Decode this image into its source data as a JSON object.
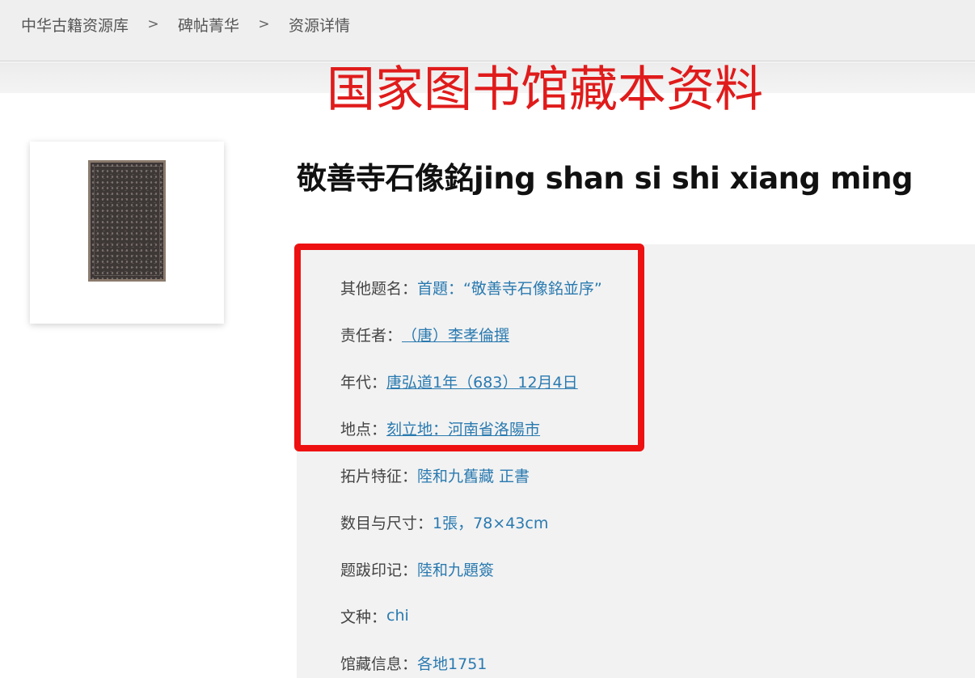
{
  "breadcrumb": {
    "items": [
      "中华古籍资源库",
      "碑帖菁华",
      "资源详情"
    ],
    "separator": ">"
  },
  "stamp_text": "国家图书馆藏本资料",
  "record": {
    "title": "敬善寺石像銘jing shan si shi xiang ming",
    "thumbnail_icon": "rubbing-thumbnail",
    "fields": [
      {
        "label": "其他题名：",
        "value": "首題：“敬善寺石像銘並序”"
      },
      {
        "label": "责任者：",
        "value": "（唐）李孝倫撰"
      },
      {
        "label": "年代：",
        "value": "唐弘道1年（683）12月4日"
      },
      {
        "label": "地点：",
        "value": "刻立地：河南省洛陽市"
      },
      {
        "label": "拓片特征：",
        "value": "陸和九舊藏 正書"
      },
      {
        "label": "数目与尺寸：",
        "value": "1張，78×43cm"
      },
      {
        "label": "题跋印记：",
        "value": "陸和九題簽"
      },
      {
        "label": "文种：",
        "value": "chi"
      },
      {
        "label": "馆藏信息：",
        "value": "各地1751"
      }
    ]
  },
  "colors": {
    "accent_link": "#2a7ab0",
    "stamp_red": "#e01b1b",
    "highlight_red": "#ee1111"
  }
}
